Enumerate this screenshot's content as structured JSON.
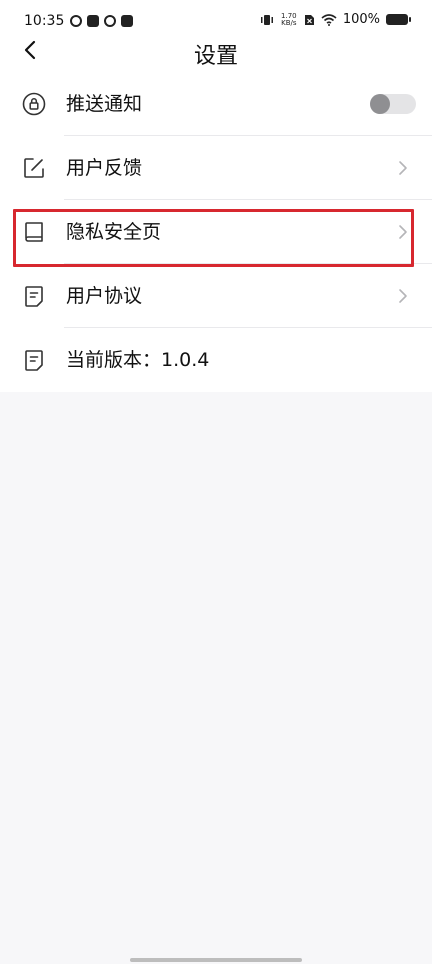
{
  "status_bar": {
    "time": "10:35",
    "network_speed_value": "1.70",
    "network_speed_unit": "KB/s",
    "battery": "100%"
  },
  "header": {
    "title": "设置",
    "back_icon": "chevron-left-icon"
  },
  "settings": {
    "items": [
      {
        "label": "推送通知",
        "icon": "lock-circle-icon",
        "control": "toggle",
        "toggle_on": false
      },
      {
        "label": "用户反馈",
        "icon": "edit-icon",
        "control": "chevron"
      },
      {
        "label": "隐私安全页",
        "icon": "book-icon",
        "control": "chevron",
        "highlighted": true
      },
      {
        "label": "用户协议",
        "icon": "document-icon",
        "control": "chevron"
      },
      {
        "label": "当前版本：1.0.4",
        "icon": "document-icon",
        "control": "none"
      }
    ]
  },
  "colors": {
    "highlight_border": "#d7282f",
    "toggle_track": "#e4e4e6",
    "toggle_knob": "#8f8f92",
    "page_background": "#f7f7f9"
  }
}
